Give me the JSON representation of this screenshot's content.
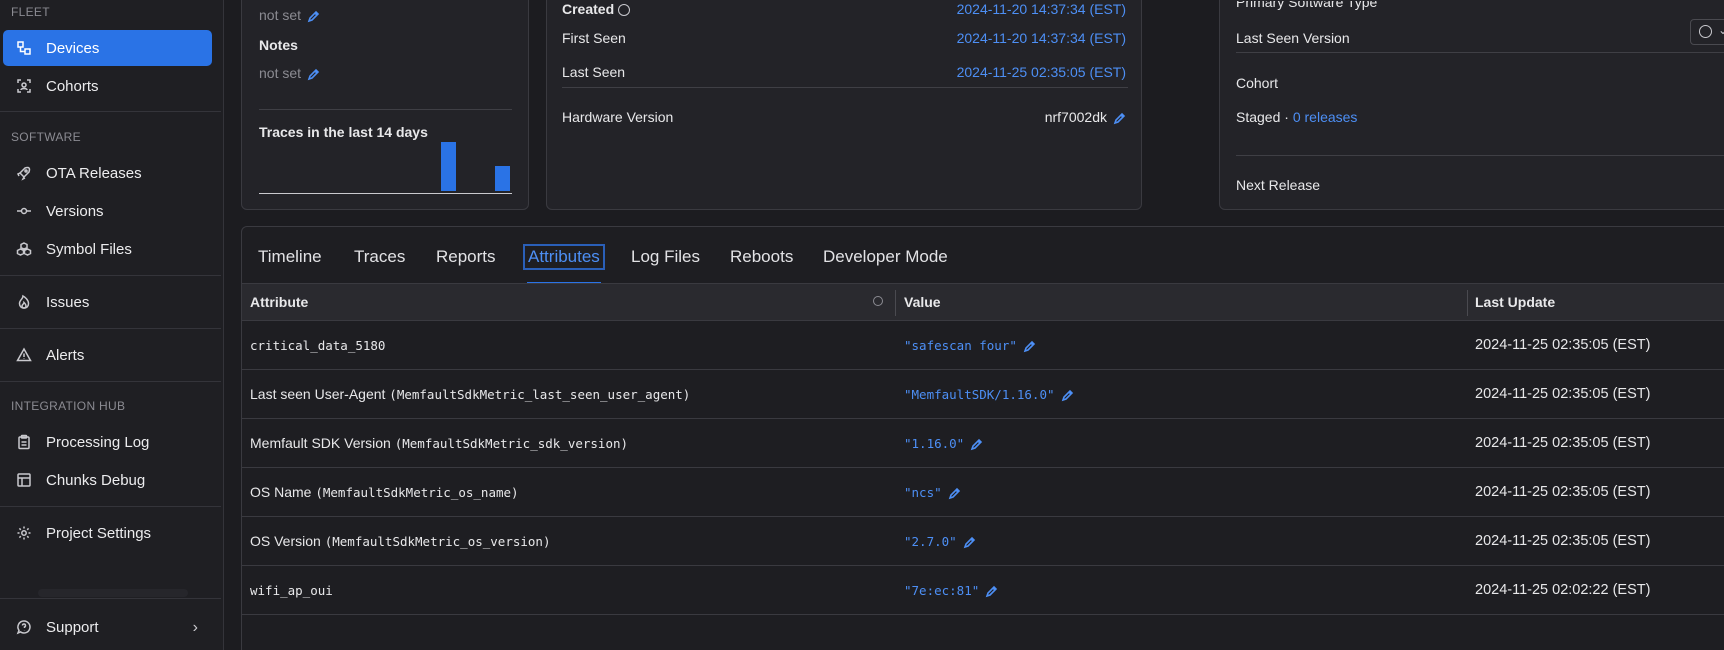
{
  "sidebar": {
    "fleet_label": "FLEET",
    "devices": "Devices",
    "cohorts": "Cohorts",
    "software_label": "SOFTWARE",
    "ota_releases": "OTA Releases",
    "versions": "Versions",
    "symbol_files": "Symbol Files",
    "issues": "Issues",
    "alerts": "Alerts",
    "integration_label": "INTEGRATION HUB",
    "processing_log": "Processing Log",
    "chunks_debug": "Chunks Debug",
    "project_settings": "Project Settings",
    "support": "Support"
  },
  "left_card": {
    "top_value": "not set",
    "notes_label": "Notes",
    "notes_value": "not set",
    "traces_title": "Traces in the last 14 days",
    "trace_counts": [
      0,
      0,
      0,
      0,
      0,
      0,
      0,
      0,
      0,
      0,
      1.0,
      0,
      0,
      0.5
    ]
  },
  "mid_card": {
    "created_label": "Created",
    "created_value": "2024-11-20 14:37:34 (EST)",
    "first_seen_label": "First Seen",
    "first_seen_value": "2024-11-20 14:37:34 (EST)",
    "last_seen_label": "Last Seen",
    "last_seen_value": "2024-11-25 02:35:05 (EST)",
    "hw_label": "Hardware Version",
    "hw_value": "nrf7002dk"
  },
  "right_card": {
    "primary_sw_label": "Primary Software Type",
    "last_seen_version_label": "Last Seen Version",
    "cohort_label": "Cohort",
    "staged_label": "Staged ·",
    "staged_value": "0 releases",
    "next_release_label": "Next Release"
  },
  "tabs": [
    "Timeline",
    "Traces",
    "Reports",
    "Attributes",
    "Log Files",
    "Reboots",
    "Developer Mode"
  ],
  "table": {
    "headers": [
      "Attribute",
      "Value",
      "Last Update"
    ],
    "rows": [
      {
        "name": "",
        "key": "critical_data_5180",
        "value": "\"safescan four\"",
        "updated": "2024-11-25 02:35:05 (EST)"
      },
      {
        "name": "Last seen User-Agent",
        "key": "(MemfaultSdkMetric_last_seen_user_agent)",
        "value": "\"MemfaultSDK/1.16.0\"",
        "updated": "2024-11-25 02:35:05 (EST)"
      },
      {
        "name": "Memfault SDK Version",
        "key": "(MemfaultSdkMetric_sdk_version)",
        "value": "\"1.16.0\"",
        "updated": "2024-11-25 02:35:05 (EST)"
      },
      {
        "name": "OS Name",
        "key": "(MemfaultSdkMetric_os_name)",
        "value": "\"ncs\"",
        "updated": "2024-11-25 02:35:05 (EST)"
      },
      {
        "name": "OS Version",
        "key": "(MemfaultSdkMetric_os_version)",
        "value": "\"2.7.0\"",
        "updated": "2024-11-25 02:35:05 (EST)"
      },
      {
        "name": "",
        "key": "wifi_ap_oui",
        "value": "\"7e:ec:81\"",
        "updated": "2024-11-25 02:02:22 (EST)"
      }
    ]
  },
  "colors": {
    "accent": "#2a73e6",
    "link": "#4d8ff5"
  }
}
